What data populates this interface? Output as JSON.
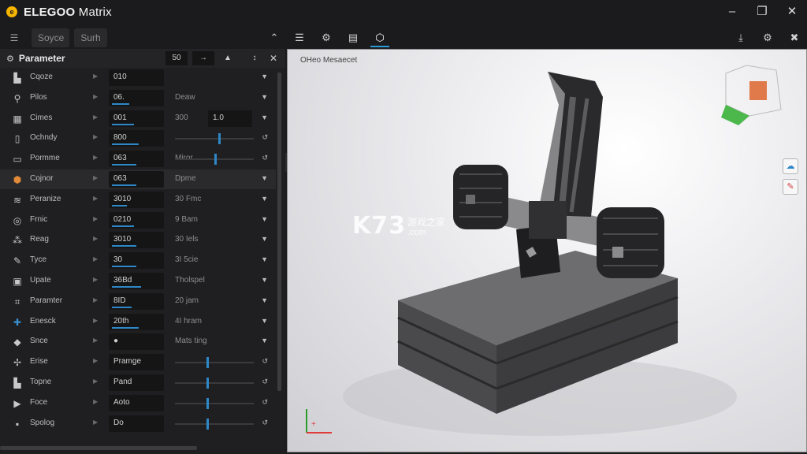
{
  "app": {
    "name_bold": "ELEGOO",
    "name_light": "Matrix"
  },
  "toolbar": {
    "menu_icon": "☰",
    "tab_1": "Soyce",
    "tab_2": "Surh",
    "nav_glyph": "⌃",
    "icons": [
      "list-icon",
      "gear-icon",
      "document-icon",
      "cube-icon"
    ]
  },
  "panel": {
    "title": "Parameter",
    "tools": [
      "50",
      "→",
      "▲",
      "↕",
      "✕"
    ],
    "rows": [
      {
        "icon": "bucket-icon",
        "label": "Cqoze",
        "value": "010",
        "value2": "",
        "bar": 0,
        "kind": "chev"
      },
      {
        "icon": "pin-icon",
        "label": "Pilos",
        "value": "06.",
        "value2": "Deaw",
        "bar": 0.35,
        "kind": "chev"
      },
      {
        "icon": "grid-icon",
        "label": "Cimes",
        "value": "001",
        "value2": "300",
        "value3": "1.0",
        "bar": 0.45,
        "kind": "chev"
      },
      {
        "icon": "book-icon",
        "label": "Ochndy",
        "value": "800",
        "value2": "",
        "bar": 0.55,
        "kind": "slider"
      },
      {
        "icon": "folder-icon",
        "label": "Pormme",
        "value": "063",
        "value2": "Miror",
        "bar": 0.5,
        "kind": "slider"
      },
      {
        "icon": "box-icon",
        "label": "Cojnor",
        "value": "063",
        "value2": "Dpme",
        "bar": 0.5,
        "kind": "chev"
      },
      {
        "icon": "layers-icon",
        "label": "Peranize",
        "value": "3010",
        "value2": "30 Fmc",
        "bar": 0.3,
        "kind": "chev"
      },
      {
        "icon": "target-icon",
        "label": "Frnic",
        "value": "0210",
        "value2": "9 Bam",
        "bar": 0.45,
        "kind": "chev"
      },
      {
        "icon": "nodes-icon",
        "label": "Reag",
        "value": "3010",
        "value2": "30 Iels",
        "bar": 0.5,
        "kind": "chev"
      },
      {
        "icon": "edit-icon",
        "label": "Tyce",
        "value": "30",
        "value2": "3I 5cie",
        "bar": 0.5,
        "kind": "chev"
      },
      {
        "icon": "image-icon",
        "label": "Upate",
        "value": "36Bd",
        "value2": "Tholspel",
        "bar": 0.6,
        "kind": "chev"
      },
      {
        "icon": "frame-icon",
        "label": "Paramter",
        "value": "8ID",
        "value2": "20 jam",
        "bar": 0.4,
        "kind": "chev"
      },
      {
        "icon": "plus-icon",
        "label": "Enesck",
        "value": "20th",
        "value2": "4I hram",
        "bar": 0.55,
        "kind": "chev"
      },
      {
        "icon": "diamond-icon",
        "label": "Snce",
        "value": "●",
        "value2": "Mats ting",
        "bar": 0,
        "kind": "chev"
      },
      {
        "icon": "fan-icon",
        "label": "Erise",
        "value": "Pramge",
        "value2": "",
        "bar": 0,
        "kind": "slider"
      },
      {
        "icon": "bucket-icon",
        "label": "Topne",
        "value": "Pand",
        "value2": "",
        "bar": 0,
        "kind": "slider"
      },
      {
        "icon": "play-icon",
        "label": "Foce",
        "value": "Aoto",
        "value2": "",
        "bar": 0,
        "kind": "slider"
      },
      {
        "icon": "save-icon",
        "label": "Spolog",
        "value": "Do",
        "value2": "",
        "bar": 0,
        "kind": "slider"
      }
    ]
  },
  "viewport": {
    "label": "OHeo Mesaecet",
    "watermark": "K73",
    "watermark_sub": "游戏之家",
    "watermark_sub2": ".com"
  }
}
